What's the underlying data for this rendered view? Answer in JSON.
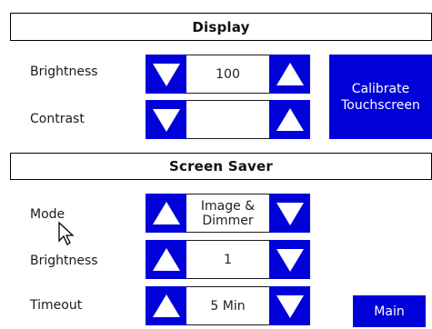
{
  "display": {
    "title": "Display",
    "brightness_label": "Brightness",
    "brightness_value": "100",
    "contrast_label": "Contrast",
    "contrast_value": "",
    "calibrate_label_line1": "Calibrate",
    "calibrate_label_line2": "Touchscreen"
  },
  "screen_saver": {
    "title": "Screen Saver",
    "mode_label": "Mode",
    "mode_value_line1": "Image &",
    "mode_value_line2": "Dimmer",
    "brightness_label": "Brightness",
    "brightness_value": "1",
    "timeout_label": "Timeout",
    "timeout_value": "5 Min"
  },
  "nav": {
    "main_label": "Main"
  },
  "icons": {
    "decrease": "arrow-down-icon",
    "increase": "arrow-up-icon",
    "cursor": "mouse-pointer-icon"
  },
  "colors": {
    "button_blue": "#0000d8",
    "header_border": "#000000",
    "background": "#ffffff"
  }
}
